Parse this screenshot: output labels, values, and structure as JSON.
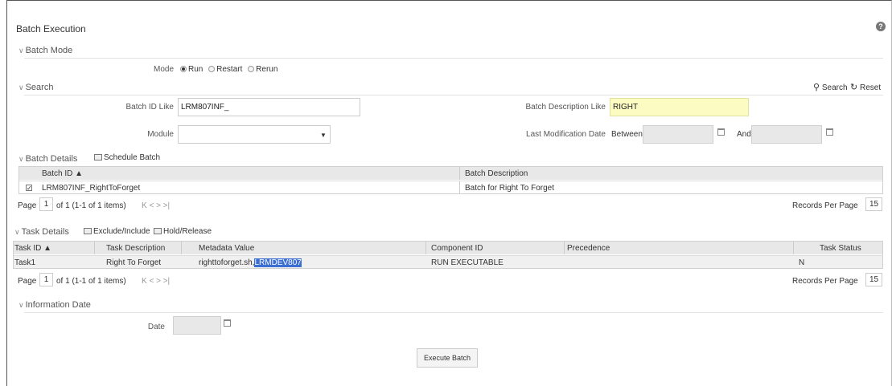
{
  "page": {
    "title": "Batch Execution",
    "help_icon": "?"
  },
  "batch_mode": {
    "header": "Batch Mode",
    "mode_label": "Mode",
    "options": [
      {
        "label": "Run",
        "selected": true
      },
      {
        "label": "Restart",
        "selected": false
      },
      {
        "label": "Rerun",
        "selected": false
      }
    ]
  },
  "search": {
    "header": "Search",
    "search_label": "Search",
    "reset_label": "Reset",
    "batch_id_label": "Batch ID Like",
    "batch_id_value": "LRM807INF_",
    "batch_desc_label": "Batch Description Like",
    "batch_desc_value": "RIGHT",
    "module_label": "Module",
    "module_value": "",
    "last_mod_label": "Last Modification Date",
    "between_label": "Between",
    "and_label": "And"
  },
  "batch_details": {
    "header": "Batch Details",
    "schedule_label": "Schedule Batch",
    "columns": [
      "Batch ID ▲",
      "Batch Description"
    ],
    "rows": [
      {
        "checked": true,
        "batch_id": "LRM807INF_RightToForget",
        "description": "Batch for Right To Forget"
      }
    ],
    "pagination": {
      "page_label": "Page",
      "page_num": "1",
      "info": "of 1 (1-1 of 1 items)",
      "nav": "K < > >|",
      "rpp_label": "Records Per Page",
      "rpp_value": "15"
    }
  },
  "task_details": {
    "header": "Task Details",
    "exclude_label": "Exclude/Include",
    "hold_label": "Hold/Release",
    "columns": [
      "Task ID ▲",
      "Task Description",
      "Metadata Value",
      "Component ID",
      "Precedence",
      "Task Status"
    ],
    "rows": [
      {
        "task_id": "Task1",
        "description": "Right To Forget",
        "metadata_prefix": "righttoforget.sh,",
        "metadata_selected": "LRMDEV807",
        "component": "RUN EXECUTABLE",
        "precedence": "",
        "status": "N"
      }
    ],
    "pagination": {
      "page_label": "Page",
      "page_num": "1",
      "info": "of 1 (1-1 of 1 items)",
      "nav": "K < > >|",
      "rpp_label": "Records Per Page",
      "rpp_value": "15"
    }
  },
  "information_date": {
    "header": "Information Date",
    "date_label": "Date",
    "date_value": ""
  },
  "execute_label": "Execute Batch",
  "colors": {
    "highlight": "#fbfbc2",
    "selection": "#3b6fd4",
    "header_bg": "#e8e8e8"
  }
}
